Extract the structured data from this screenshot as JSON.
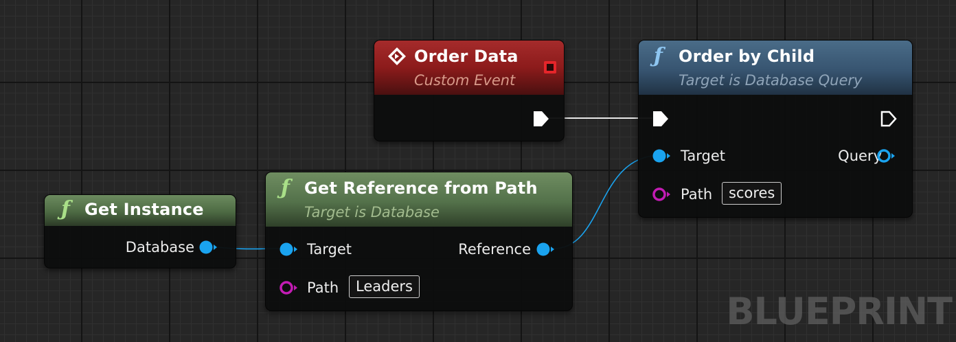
{
  "nodes": {
    "get_instance": {
      "title": "Get Instance",
      "outputs": {
        "database": "Database"
      }
    },
    "get_reference": {
      "title": "Get Reference from Path",
      "subtitle": "Target is Database",
      "inputs": {
        "target": "Target",
        "path": "Path",
        "path_value": "Leaders"
      },
      "outputs": {
        "reference": "Reference"
      }
    },
    "order_data": {
      "title": "Order Data",
      "subtitle": "Custom Event"
    },
    "order_by_child": {
      "title": "Order by Child",
      "subtitle": "Target is Database Query",
      "inputs": {
        "target": "Target",
        "path": "Path",
        "path_value": "scores"
      },
      "outputs": {
        "query": "Query"
      }
    }
  },
  "watermark": "BLUEPRINT",
  "colors": {
    "function_header": "#5f7d52",
    "event_header": "#8e1c1c",
    "query_header": "#3c5a74",
    "object_pin": "#1aa3ef",
    "string_pin": "#c31cb4",
    "exec_pin": "#ffffff",
    "event_delegate": "#e5252a"
  }
}
